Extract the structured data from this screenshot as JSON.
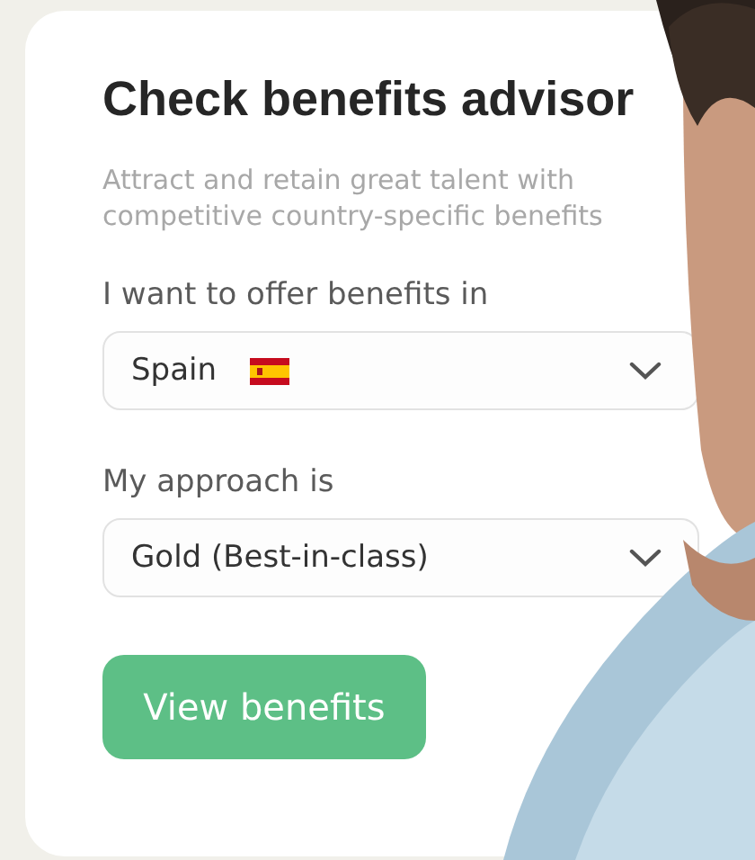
{
  "card": {
    "title": "Check benefits advisor",
    "subtitle": "Attract and retain great talent with competitive country-specific benefits"
  },
  "fields": [
    {
      "kind": "country",
      "label": "I want to offer benefits in",
      "value": "Spain"
    },
    {
      "kind": "plain",
      "label": "My approach is",
      "value": "Gold (Best-in-class)"
    }
  ],
  "button": {
    "label": "View benefits"
  }
}
